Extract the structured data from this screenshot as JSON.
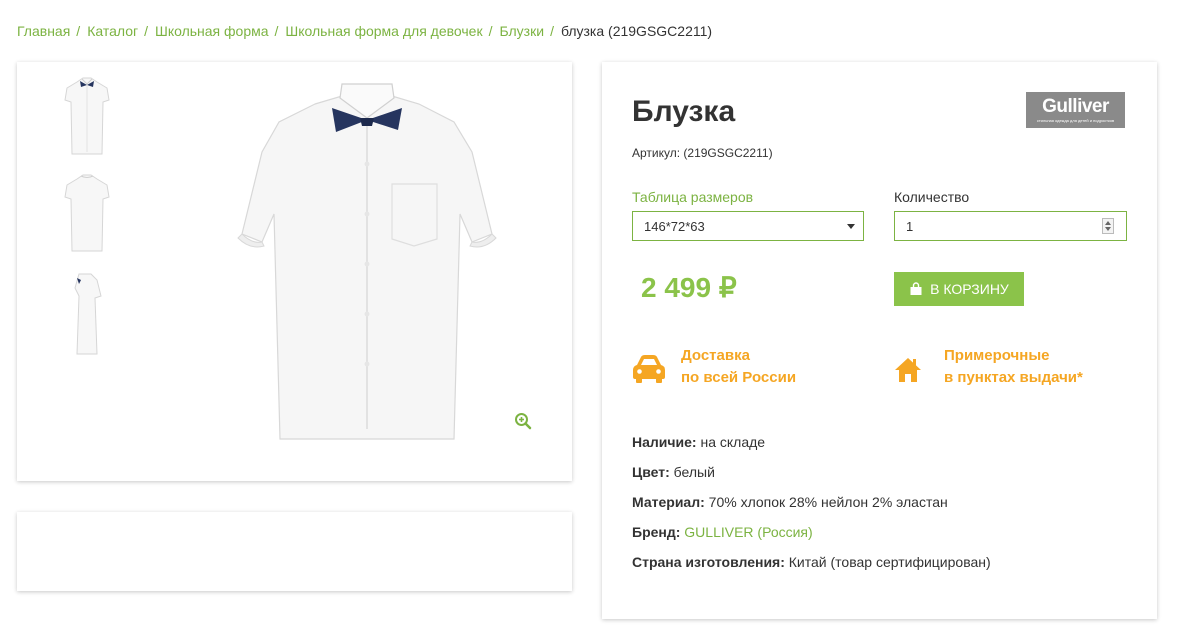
{
  "breadcrumb": {
    "items": [
      "Главная",
      "Каталог",
      "Школьная форма",
      "Школьная форма для девочек",
      "Блузки"
    ],
    "separator": "/",
    "current": "блузка (219GSGC2211)"
  },
  "product": {
    "title": "Блузка",
    "sku": "Артикул: (219GSGC2211)",
    "brand_logo": {
      "word": "Gulliver",
      "tagline": "стильная одежда для детей и подростков"
    },
    "size_label": "Таблица размеров",
    "size_value": "146*72*63",
    "qty_label": "Количество",
    "qty_value": "1",
    "price": "2 499 ₽",
    "cart_button": "В КОРЗИНУ"
  },
  "features": {
    "delivery": [
      "Доставка",
      "по всей России"
    ],
    "fitting": [
      "Примерочные",
      "в пунктах выдачи*"
    ]
  },
  "properties": {
    "availability_label": "Наличие:",
    "availability_value": "на складе",
    "color_label": "Цвет:",
    "color_value": "белый",
    "material_label": "Материал:",
    "material_value": "70% хлопок 28% нейлон 2% эластан",
    "brand_label": "Бренд:",
    "brand_value": "GULLIVER (Россия)",
    "country_label": "Страна изготовления:",
    "country_value": "Китай (товар сертифицирован)"
  },
  "colors": {
    "accent_green": "#8bc34a",
    "link_green": "#7cb342",
    "feature_orange": "#f5a623"
  }
}
